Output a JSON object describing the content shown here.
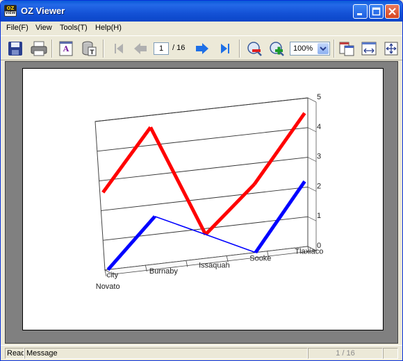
{
  "window": {
    "title": "OZ Viewer",
    "app_icon_text_top": "OZ",
    "app_icon_text_bottom": "VIEW"
  },
  "menu": {
    "items": [
      {
        "label": "File(F)"
      },
      {
        "label": "View"
      },
      {
        "label": "Tools(T)"
      },
      {
        "label": "Help(H)"
      }
    ]
  },
  "toolbar": {
    "current_page": "1",
    "total_pages": "/ 16",
    "zoom": "100%",
    "icons": [
      "save-icon",
      "print-icon",
      "export-text-icon",
      "database-text-icon",
      "first-page-icon",
      "previous-page-icon",
      "next-page-icon",
      "last-page-icon",
      "zoom-out-icon",
      "zoom-in-icon",
      "copy-icon",
      "fit-width-icon",
      "fit-page-icon"
    ]
  },
  "colors": {
    "title_bar": "#1452d6",
    "series_red": "#ff0000",
    "series_blue": "#0000ff",
    "nav_blue": "#1e6fe6",
    "nav_gray": "#b0b0b0"
  },
  "chart_data": {
    "type": "line",
    "title": "",
    "xlabel": "",
    "ylabel": "",
    "categories": [
      "city",
      "Novato",
      "Burnaby",
      "Issaquah",
      "Sooke",
      "Tlaxiaco"
    ],
    "ylim": [
      0,
      5
    ],
    "yticks": [
      "0",
      "1",
      "2",
      "3",
      "4",
      "5"
    ],
    "grid": true,
    "three_d": true,
    "series": [
      {
        "values": [
          2.6,
          4.6,
          0.8,
          2.3,
          4.5
        ],
        "color": "#ff0000"
      },
      {
        "values": [
          0.0,
          1.6,
          0.8,
          0.0,
          2.2
        ],
        "color": "#0000ff"
      }
    ]
  },
  "status": {
    "ready": "Ready",
    "message": "Message",
    "page": "1 / 16"
  }
}
